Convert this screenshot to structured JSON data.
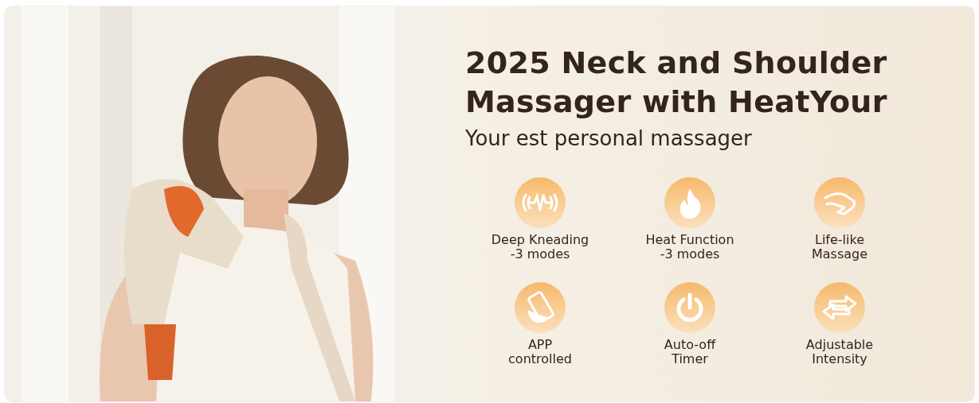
{
  "banner": {
    "kind": "picture",
    "title_lines": [
      "2025 Neck and Shoulder",
      "Massager with HeatYour"
    ],
    "subtitle": "Your est personal massager"
  },
  "features": [
    {
      "kind": "wave",
      "lines": [
        "Deep Kneading",
        "-3 modes"
      ]
    },
    {
      "kind": "flame",
      "lines": [
        "Heat Function",
        "-3 modes"
      ]
    },
    {
      "kind": "hand",
      "lines": [
        "Life-like",
        "Massage"
      ]
    },
    {
      "kind": "phone",
      "lines": [
        "APP",
        "controlled"
      ]
    },
    {
      "kind": "power",
      "lines": [
        "Auto-off",
        "Timer"
      ]
    },
    {
      "kind": "arrows",
      "lines": [
        "Adjustable",
        "Intensity"
      ]
    }
  ]
}
